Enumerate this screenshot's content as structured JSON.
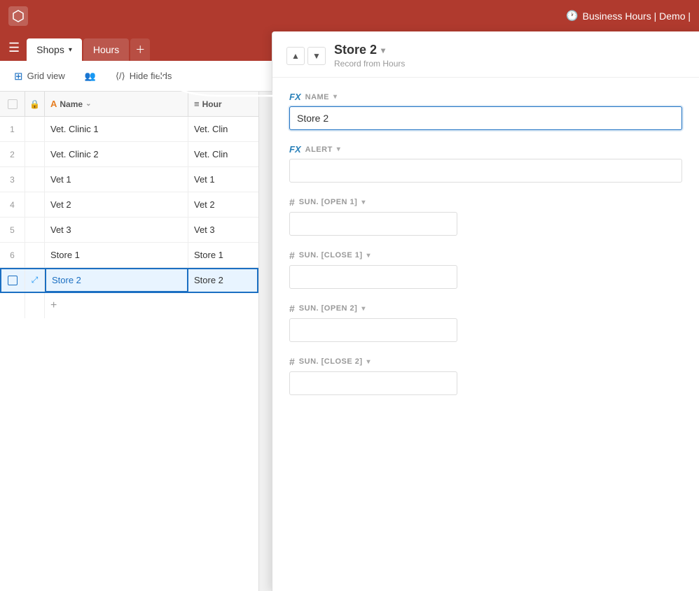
{
  "topbar": {
    "logo": "⬡",
    "title": "Business Hours | Demo |",
    "clock": "🕐"
  },
  "tabs": {
    "shops_label": "Shops",
    "hours_label": "Hours",
    "add_label": "+"
  },
  "toolbar": {
    "view_label": "Grid view",
    "people_label": "",
    "hide_fields_label": "Hide fields"
  },
  "grid": {
    "columns": [
      {
        "icon": "A",
        "label": "Name",
        "type": "text"
      },
      {
        "icon": "≡",
        "label": "Hour",
        "type": "lookup"
      }
    ],
    "rows": [
      {
        "id": 1,
        "name": "Vet. Clinic 1",
        "hour": "Vet. Clin"
      },
      {
        "id": 2,
        "name": "Vet. Clinic 2",
        "hour": "Vet. Clin"
      },
      {
        "id": 3,
        "name": "Vet 1",
        "hour": "Vet 1"
      },
      {
        "id": 4,
        "name": "Vet 2",
        "hour": "Vet 2"
      },
      {
        "id": 5,
        "name": "Vet 3",
        "hour": "Vet 3"
      },
      {
        "id": 6,
        "name": "Store 1",
        "hour": "Store 1"
      },
      {
        "id": 7,
        "name": "Store 2",
        "hour": "Store 2",
        "active": true
      }
    ]
  },
  "record": {
    "title": "Store 2",
    "subtitle": "Record from Hours",
    "fields": {
      "name_label": "NAME",
      "name_value": "Store 2",
      "alert_label": "ALERT",
      "alert_value": "",
      "sun_open1_label": "SUN. [OPEN 1]",
      "sun_open1_value": "",
      "sun_close1_label": "SUN. [CLOSE 1]",
      "sun_close1_value": "",
      "sun_open2_label": "SUN. [OPEN 2]",
      "sun_open2_value": "",
      "sun_close2_label": "SUN. [CLOSE 2]",
      "sun_close2_value": ""
    }
  }
}
